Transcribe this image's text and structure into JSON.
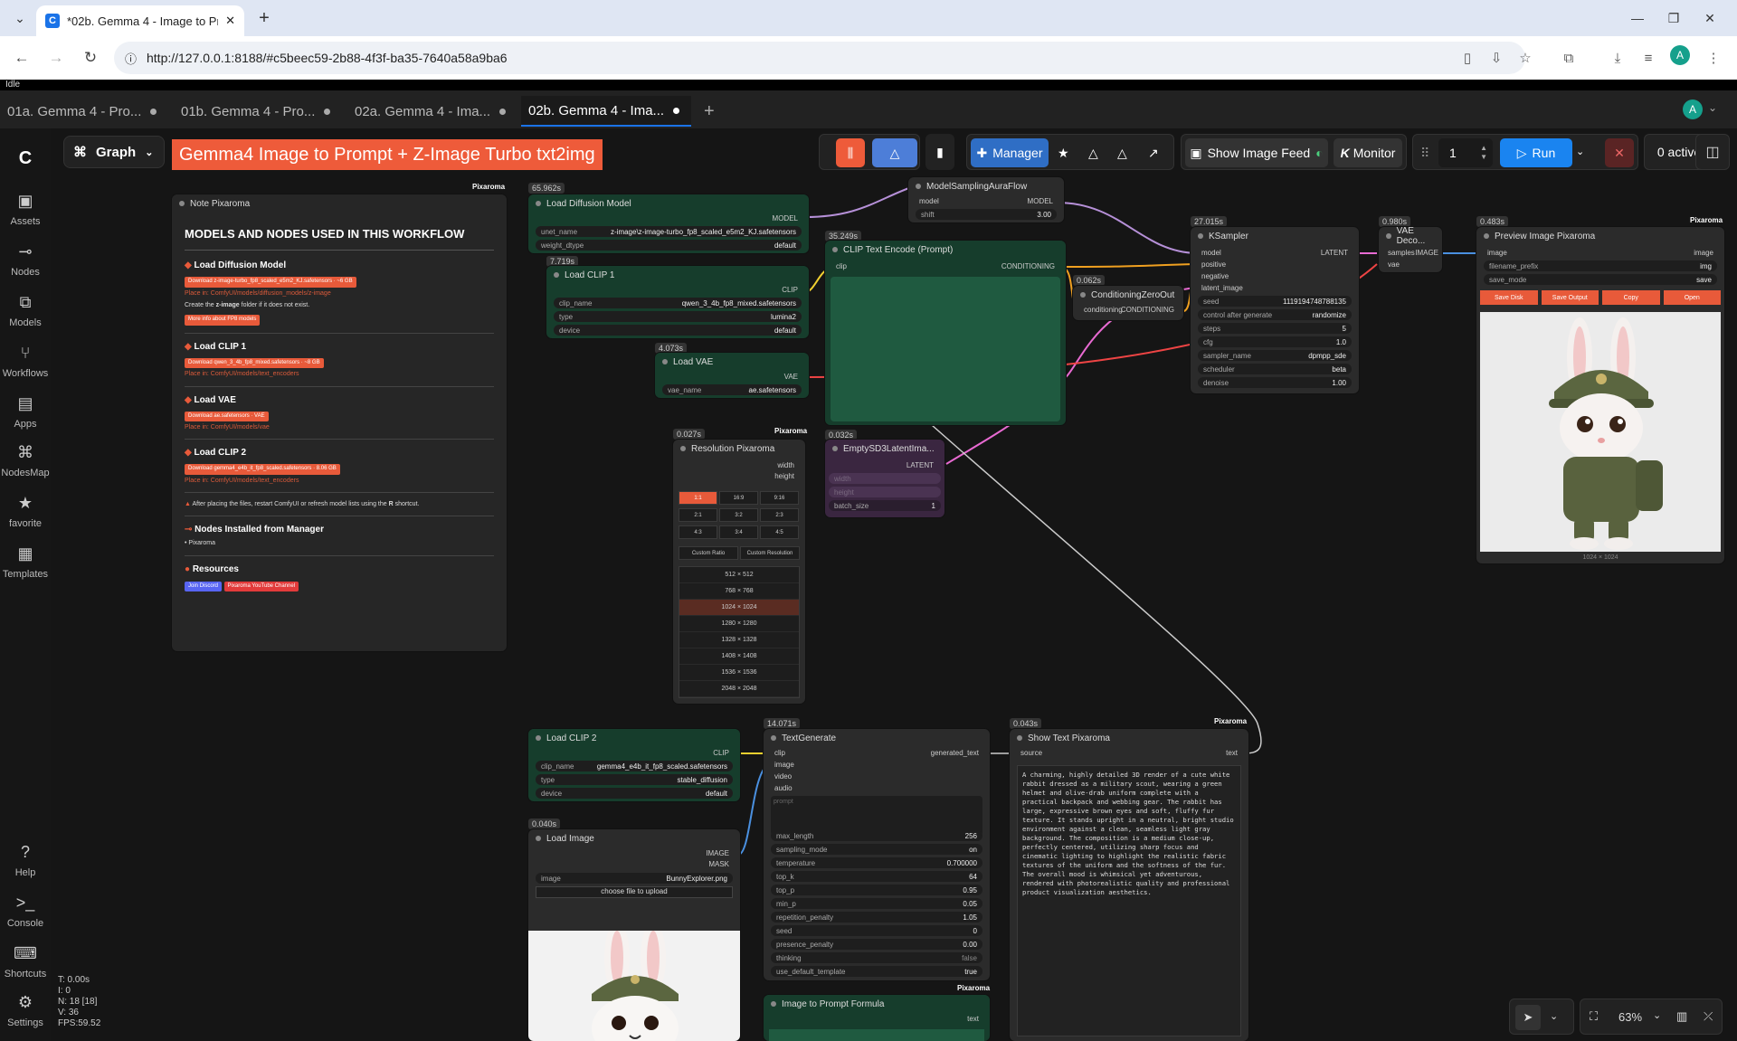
{
  "browser": {
    "tab_title": "*02b. Gemma 4 - Image to Prom",
    "url": "http://127.0.0.1:8188/#c5beec59-2b88-4f3f-ba35-7640a58a9ba6",
    "profile_initial": "A"
  },
  "app": {
    "status": "Idle",
    "tabs": [
      {
        "label": "01a. Gemma 4 - Pro..."
      },
      {
        "label": "01b. Gemma 4 - Pro..."
      },
      {
        "label": "02a. Gemma 4 - Ima..."
      },
      {
        "label": "02b. Gemma 4 - Ima..."
      }
    ],
    "user_initial": "A",
    "graph_label": "Graph",
    "workflow_title": "Gemma4 Image to Prompt + Z-Image Turbo txt2img"
  },
  "sidebar": {
    "items": [
      {
        "label": "Assets"
      },
      {
        "label": "Nodes"
      },
      {
        "label": "Models"
      },
      {
        "label": "Workflows"
      },
      {
        "label": "Apps"
      },
      {
        "label": "NodesMap"
      },
      {
        "label": "favorite"
      },
      {
        "label": "Templates"
      }
    ],
    "bottom": [
      {
        "label": "Help"
      },
      {
        "label": "Console"
      },
      {
        "label": "Shortcuts"
      },
      {
        "label": "Settings"
      }
    ]
  },
  "toolbar": {
    "manager": "Manager",
    "show_feed": "Show Image Feed",
    "monitor": "Monitor",
    "queue_count": "1",
    "run": "Run",
    "active": "0 active"
  },
  "note": {
    "title": "Note Pixaroma",
    "brand": "Pixaroma",
    "heading": "MODELS AND NODES USED IN THIS WORKFLOW",
    "s1": "Load Diffusion Model",
    "s1_dl": "Download z-image-turbo_fp8_scaled_e5m2_KJ.safetensors · ~6 GB",
    "s1_place": "Place in: ComfyUI/models/diffusion_models/z-image",
    "s1_create_pre": "Create the",
    "s1_create_name": "z-image",
    "s1_create_post": "folder if it does not exist.",
    "s1_more": "More info about FP8 models",
    "s2": "Load CLIP 1",
    "s2_dl": "Download qwen_3_4b_fp8_mixed.safetensors · ~8 GB",
    "s2_place": "Place in: ComfyUI/models/text_encoders",
    "s3": "Load VAE",
    "s3_dl": "Download ae.safetensors · VAE",
    "s3_place": "Place in: ComfyUI/models/vae",
    "s4": "Load CLIP 2",
    "s4_dl": "Download gemma4_e4b_it_fp8_scaled.safetensors · 8.06 GB",
    "s4_place": "Place in: ComfyUI/models/text_encoders",
    "warn_pre": "After placing the files, restart ComfyUI or refresh model lists using the",
    "warn_key": "R",
    "warn_post": "shortcut.",
    "nodes_h": "Nodes Installed from Manager",
    "nodes_item": "Pixaroma",
    "res_h": "Resources",
    "discord": "Join Discord",
    "youtube": "Pixaroma YouTube Channel"
  },
  "nodes": {
    "ldm": {
      "title": "Load Diffusion Model",
      "time": "65.962s",
      "out": "MODEL",
      "unet_k": "unet_name",
      "unet_v": "z-image\\z-image-turbo_fp8_scaled_e5m2_KJ.safetensors",
      "wd_k": "weight_dtype",
      "wd_v": "default"
    },
    "clip1": {
      "title": "Load CLIP 1",
      "time": "7.719s",
      "out": "CLIP",
      "k1": "clip_name",
      "v1": "qwen_3_4b_fp8_mixed.safetensors",
      "k2": "type",
      "v2": "lumina2",
      "k3": "device",
      "v3": "default"
    },
    "vae": {
      "title": "Load VAE",
      "time": "4.073s",
      "out": "VAE",
      "k1": "vae_name",
      "v1": "ae.safetensors"
    },
    "msaf": {
      "title": "ModelSamplingAuraFlow",
      "in": "model",
      "out": "MODEL",
      "k1": "shift",
      "v1": "3.00"
    },
    "cte": {
      "title": "CLIP Text Encode (Prompt)",
      "time": "35.249s",
      "in": "clip",
      "out": "CONDITIONING"
    },
    "czo": {
      "title": "ConditioningZeroOut",
      "time": "0.062s",
      "in": "conditioning",
      "out": "CONDITIONING"
    },
    "ks": {
      "title": "KSampler",
      "time": "27.015s",
      "ins": [
        "model",
        "positive",
        "negative",
        "latent_image"
      ],
      "out": "LATENT",
      "w": [
        [
          "seed",
          "1119194748788135"
        ],
        [
          "control after generate",
          "randomize"
        ],
        [
          "steps",
          "5"
        ],
        [
          "cfg",
          "1.0"
        ],
        [
          "sampler_name",
          "dpmpp_sde"
        ],
        [
          "scheduler",
          "beta"
        ],
        [
          "denoise",
          "1.00"
        ]
      ]
    },
    "vaed": {
      "title": "VAE Deco...",
      "time": "0.980s",
      "in1": "samples",
      "in2": "vae",
      "out": "IMAGE"
    },
    "prev": {
      "title": "Preview Image Pixaroma",
      "time": "0.483s",
      "brand": "Pixaroma",
      "in": "image",
      "out": "image",
      "k1": "filename_prefix",
      "v1": "img",
      "k2": "save_mode",
      "v2": "save",
      "b1": "Save Disk",
      "b2": "Save Output",
      "b3": "Copy",
      "b4": "Open",
      "dims": "1024 × 1024"
    },
    "res": {
      "title": "Resolution Pixaroma",
      "time": "0.027s",
      "brand": "Pixaroma",
      "o1": "width",
      "o2": "height",
      "ratios": [
        "1:1",
        "16:9",
        "9:16",
        "2:1",
        "3:2",
        "2:3",
        "4:3",
        "3:4",
        "4:5"
      ],
      "custom1": "Custom Ratio",
      "custom2": "Custom Resolution",
      "sizes": [
        "512 × 512",
        "768 × 768",
        "1024 × 1024",
        "1280 × 1280",
        "1328 × 1328",
        "1408 × 1408",
        "1536 × 1536",
        "2048 × 2048"
      ]
    },
    "esd": {
      "title": "EmptySD3LatentIma...",
      "time": "0.032s",
      "out": "LATENT",
      "i1": "width",
      "i2": "height",
      "k1": "batch_size",
      "v1": "1"
    },
    "clip2": {
      "title": "Load CLIP 2",
      "out": "CLIP",
      "k1": "clip_name",
      "v1": "gemma4_e4b_it_fp8_scaled.safetensors",
      "k2": "type",
      "v2": "stable_diffusion",
      "k3": "device",
      "v3": "default"
    },
    "limg": {
      "title": "Load Image",
      "time": "0.040s",
      "o1": "IMAGE",
      "o2": "MASK",
      "k1": "image",
      "v1": "BunnyExplorer.png",
      "upload": "choose file to upload"
    },
    "tg": {
      "title": "TextGenerate",
      "time": "14.071s",
      "ins": [
        "clip",
        "image",
        "video",
        "audio"
      ],
      "out": "generated_text",
      "prompt_label": "prompt",
      "w": [
        [
          "max_length",
          "256"
        ],
        [
          "sampling_mode",
          "on"
        ],
        [
          "temperature",
          "0.700000"
        ],
        [
          "top_k",
          "64"
        ],
        [
          "top_p",
          "0.95"
        ],
        [
          "min_p",
          "0.05"
        ],
        [
          "repetition_penalty",
          "1.05"
        ],
        [
          "seed",
          "0"
        ],
        [
          "presence_penalty",
          "0.00"
        ],
        [
          "thinking",
          "false"
        ],
        [
          "use_default_template",
          "true"
        ]
      ]
    },
    "show": {
      "title": "Show Text Pixaroma",
      "time": "0.043s",
      "brand": "Pixaroma",
      "in": "source",
      "out": "text",
      "text": "A charming, highly detailed 3D render of a cute white rabbit dressed as a military scout, wearing a green helmet and olive-drab uniform complete with a practical backpack and webbing gear. The rabbit has large, expressive brown eyes and soft, fluffy fur texture. It stands upright in a neutral, bright studio environment against a clean, seamless light gray background. The composition is a medium close-up, perfectly centered, utilizing sharp focus and cinematic lighting to highlight the realistic fabric textures of the uniform and the softness of the fur. The overall mood is whimsical yet adventurous, rendered with photorealistic quality and professional product visualization aesthetics."
    },
    "ipf": {
      "title": "Image to Prompt Formula",
      "brand": "Pixaroma",
      "out": "text"
    }
  },
  "stats": [
    "T: 0.00s",
    "I: 0",
    "N: 18 [18]",
    "V: 36",
    "FPS:59.52"
  ],
  "zoom": "63%"
}
